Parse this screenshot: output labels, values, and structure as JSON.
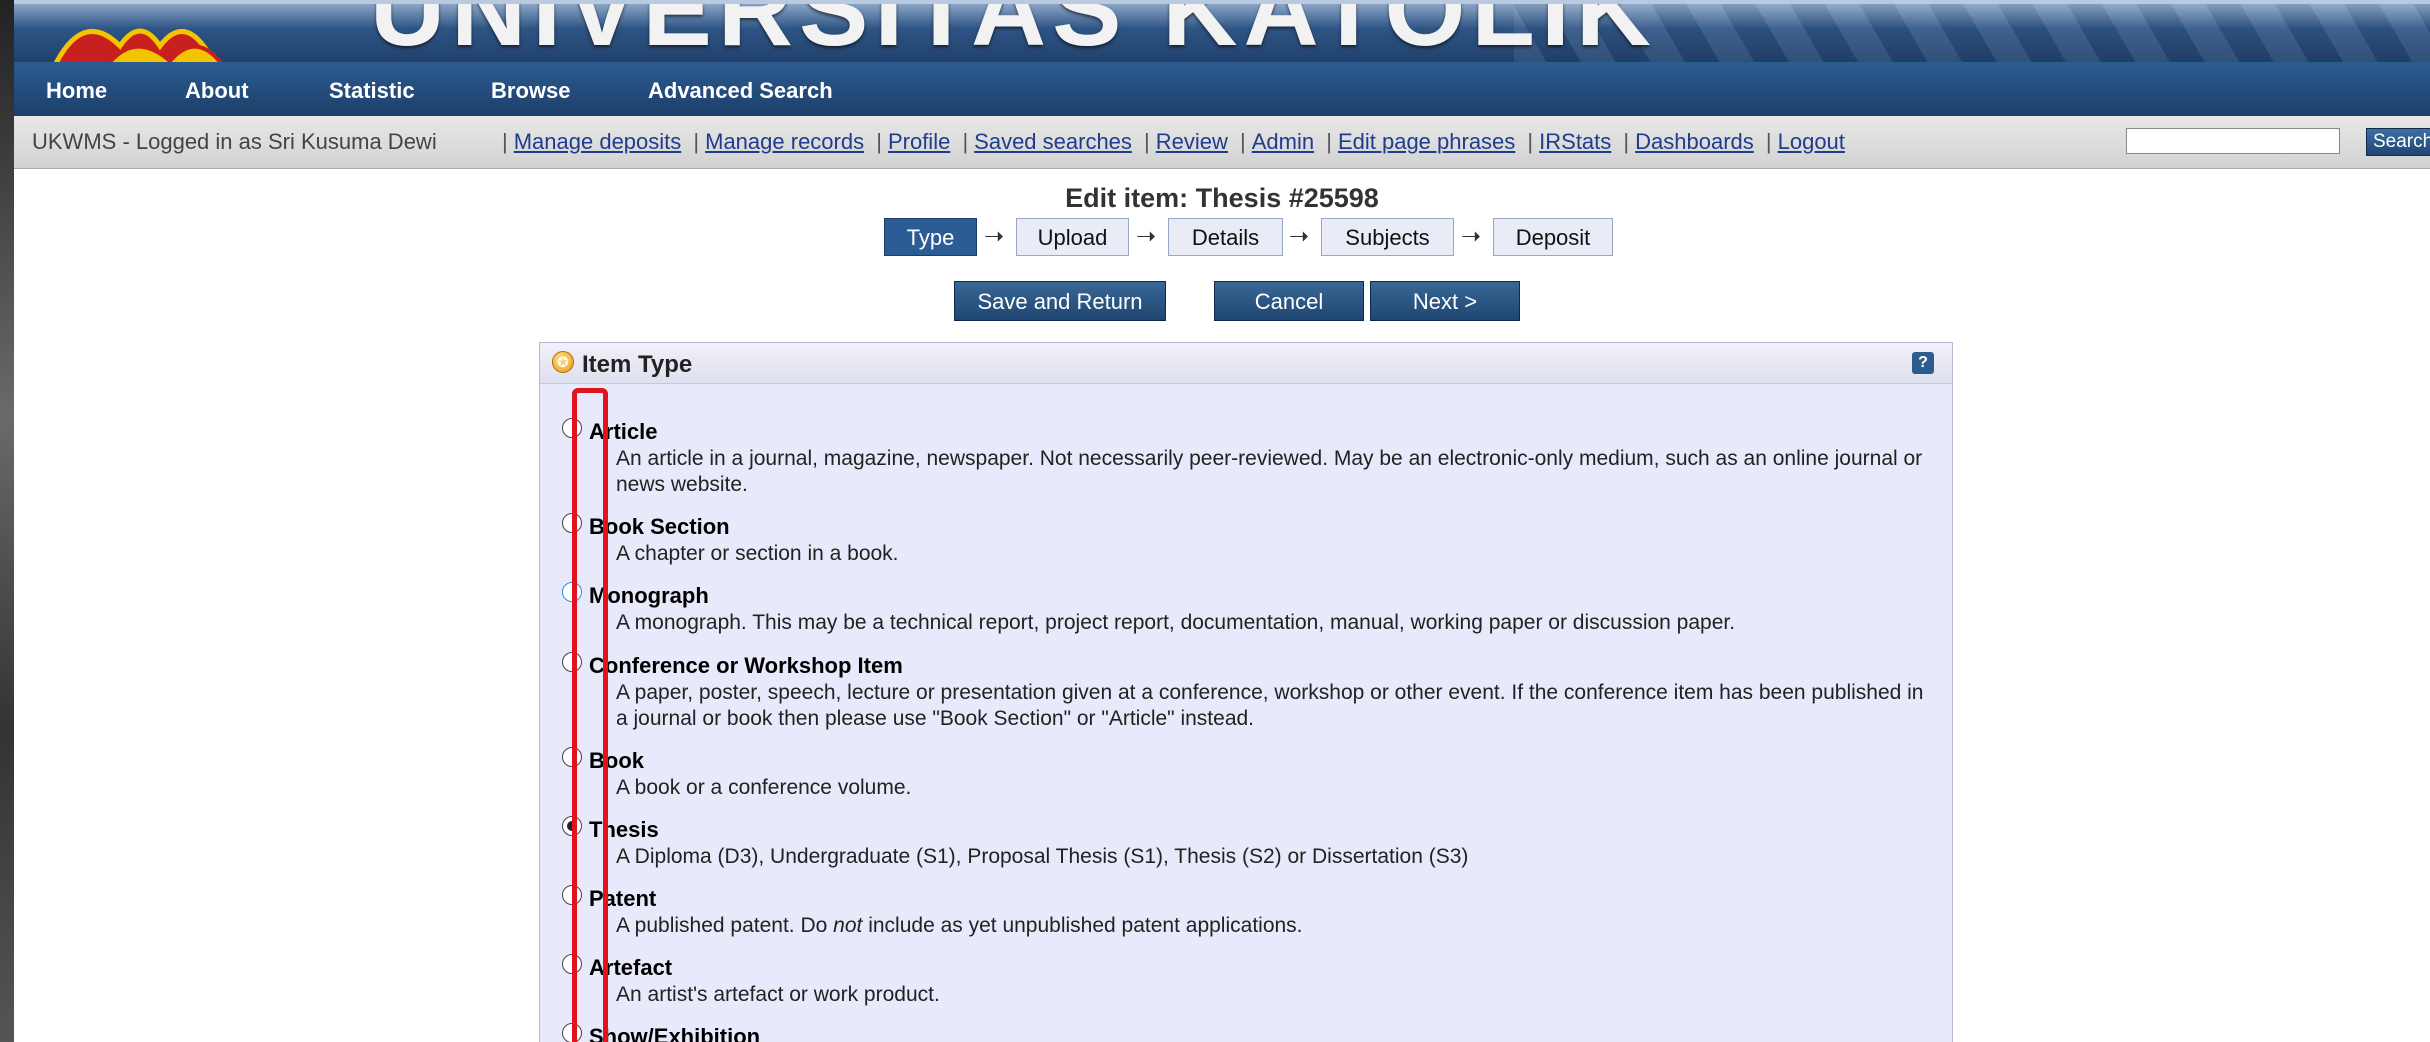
{
  "banner": {
    "title": "UNIVERSITAS KATOLIK"
  },
  "nav": {
    "items": [
      "Home",
      "About",
      "Statistic",
      "Browse",
      "Advanced Search"
    ]
  },
  "login": {
    "who": "UKWMS - Logged in as Sri Kusuma Dewi",
    "links": [
      "Manage deposits",
      "Manage records",
      "Profile",
      "Saved searches",
      "Review",
      "Admin",
      "Edit page phrases",
      "IRStats",
      "Dashboards",
      "Logout"
    ],
    "search_value": "",
    "search_button": "Search"
  },
  "edit": {
    "title": "Edit item: Thesis #25598",
    "workflow": [
      "Type",
      "Upload",
      "Details",
      "Subjects",
      "Deposit"
    ],
    "active_step": "Type",
    "buttons": {
      "save": "Save and Return",
      "cancel": "Cancel",
      "next": "Next >"
    }
  },
  "panel": {
    "title": "Item Type",
    "help": "?",
    "options": [
      {
        "name": "Article",
        "desc": "An article in a journal, magazine, newspaper. Not necessarily peer-reviewed. May be an electronic-only medium, such as an online journal or news website.",
        "selected": false
      },
      {
        "name": "Book Section",
        "desc": "A chapter or section in a book.",
        "selected": false
      },
      {
        "name": "Monograph",
        "desc": "A monograph. This may be a technical report, project report, documentation, manual, working paper or discussion paper.",
        "selected": false
      },
      {
        "name": "Conference or Workshop Item",
        "desc": "A paper, poster, speech, lecture or presentation given at a conference, workshop or other event. If the conference item has been published in a journal or book then please use \"Book Section\" or \"Article\" instead.",
        "selected": false
      },
      {
        "name": "Book",
        "desc": "A book or a conference volume.",
        "selected": false
      },
      {
        "name": "Thesis",
        "desc": "A Diploma (D3), Undergraduate (S1), Proposal Thesis (S1), Thesis (S2) or Dissertation (S3)",
        "selected": true
      },
      {
        "name": "Patent",
        "desc_pre": "A published patent. Do ",
        "desc_em": "not",
        "desc_post": " include as yet unpublished patent applications.",
        "selected": false
      },
      {
        "name": "Artefact",
        "desc": "An artist's artefact or work product.",
        "selected": false
      },
      {
        "name": "Show/Exhibition",
        "desc": "",
        "selected": false
      }
    ]
  },
  "colors": {
    "nav": "#1c3f6a",
    "panel": "#e8e9fb",
    "highlight_box": "#e0141c"
  }
}
